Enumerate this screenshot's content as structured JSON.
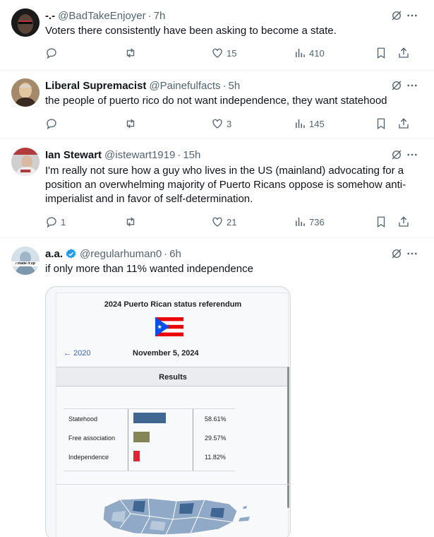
{
  "colors": {
    "text": "#0f1419",
    "muted": "#536471",
    "verified": "#1d9bf0",
    "bar_statehood": "#3f6792",
    "bar_free": "#858556",
    "bar_independence": "#e8202f",
    "wiki_link": "#3366cc"
  },
  "tweets": [
    {
      "name": "-.-",
      "handle": "@BadTakeEnjoyer",
      "sep": "·",
      "time": "7h",
      "text": "Voters there consistently have been asking to become a state.",
      "replies": "",
      "retweets": "",
      "likes": "15",
      "views": "410"
    },
    {
      "name": "Liberal Supremacist",
      "handle": "@Painefulfacts",
      "sep": "·",
      "time": "5h",
      "text": "the people of puerto rico do not want independence, they want statehood",
      "replies": "",
      "retweets": "",
      "likes": "3",
      "views": "145"
    },
    {
      "name": "Ian Stewart",
      "handle": "@istewart1919",
      "sep": "·",
      "time": "15h",
      "text": "I'm really not sure how a guy who lives in the US (mainland) advocating for a position an overwhelming majority of Puerto Ricans oppose is somehow anti-imperialist and in favor of self-determination.",
      "replies": "1",
      "retweets": "",
      "likes": "21",
      "views": "736"
    },
    {
      "name": "a.a.",
      "handle": "@regularhuman0",
      "sep": "·",
      "time": "6h",
      "text": "if only more than 11% wanted independence",
      "avatar_text": "I made it up"
    }
  ],
  "card": {
    "title": "2024 Puerto Rican status referendum",
    "prev_link": "← 2020",
    "date": "November 5, 2024",
    "results_heading": "Results",
    "rows": [
      {
        "label": "Statehood",
        "percent": "58.61%",
        "value": 58.61,
        "color": "#3f6792"
      },
      {
        "label": "Free association",
        "percent": "29.57%",
        "value": 29.57,
        "color": "#858556"
      },
      {
        "label": "Independence",
        "percent": "11.82%",
        "value": 11.82,
        "color": "#e8202f"
      }
    ]
  }
}
